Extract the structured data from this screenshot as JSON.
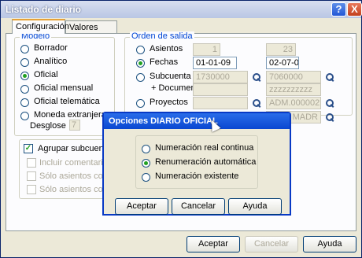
{
  "window": {
    "title": "Listado de diario",
    "help": "?",
    "close": "X"
  },
  "tabs": [
    {
      "label": "Configuración"
    },
    {
      "label": "Valores Iniciales"
    }
  ],
  "modelo": {
    "legend": "Modelo",
    "options": [
      "Borrador",
      "Analítico",
      "Oficial",
      "Oficial mensual",
      "Oficial telemática",
      "Moneda extranjera"
    ],
    "selected": "Oficial",
    "desglose_label": "Desglose",
    "desglose_value": "7"
  },
  "orden": {
    "legend": "Orden de salida",
    "asientos": {
      "label": "Asientos",
      "from": "1",
      "to": "23"
    },
    "fechas": {
      "label": "Fechas",
      "from": "01-01-09",
      "to": "02-07-09"
    },
    "subcuenta": {
      "label": "Subcuenta",
      "from": "1730000",
      "to": "7060000"
    },
    "documento": {
      "label": "+ Documento",
      "to": "zzzzzzzzzz"
    },
    "proyectos": {
      "label": "Proyectos",
      "to": "ADM.000002"
    },
    "extra_to": "MADR",
    "selected": "Fechas"
  },
  "checks": [
    {
      "label": "Agrupar subcuentas",
      "checked": true,
      "enabled": true
    },
    {
      "label": "Incluir comentarios e",
      "checked": false,
      "enabled": false
    },
    {
      "label": "Sólo asientos con co",
      "checked": false,
      "enabled": false
    },
    {
      "label": "Sólo asientos con mo",
      "checked": false,
      "enabled": false
    }
  ],
  "buttons": {
    "accept": "Aceptar",
    "cancel": "Cancelar",
    "help": "Ayuda"
  },
  "dialog": {
    "title": "Opciones DIARIO OFICIAL",
    "options": [
      "Numeración real continua",
      "Renumeración automática",
      "Numeración existente"
    ],
    "selected": "Renumeración automática",
    "accept": "Aceptar",
    "cancel": "Cancelar",
    "help": "Ayuda"
  }
}
